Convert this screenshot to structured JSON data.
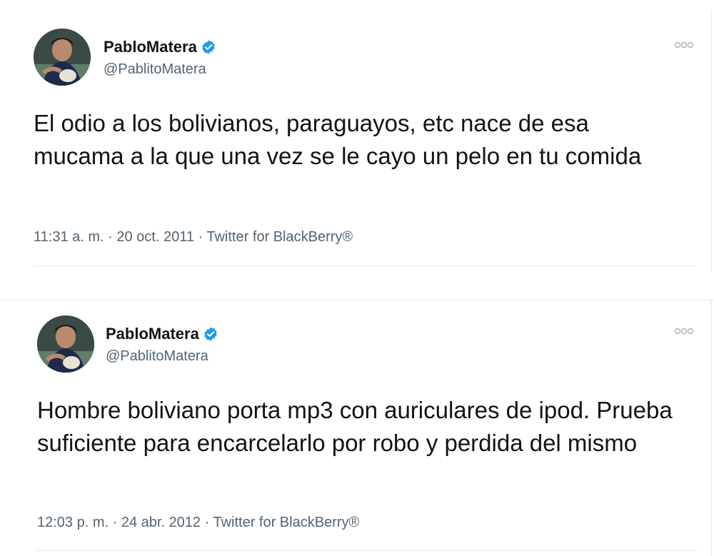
{
  "tweets": [
    {
      "display_name": "PabloMatera",
      "handle": "@PablitoMatera",
      "text": "El odio a los bolivianos, paraguayos, etc nace de esa mucama a la que una vez se le cayo un pelo en tu comida",
      "meta": "11:31 a. m. · 20 oct. 2011 · Twitter for BlackBerry®",
      "avatar_icon": "profile-photo",
      "verified_icon": "verified-badge-icon",
      "more_icon": "more-options-icon"
    },
    {
      "display_name": "PabloMatera",
      "handle": "@PablitoMatera",
      "text": "Hombre boliviano porta mp3 con auriculares de ipod. Prueba suficiente para encarcelarlo por robo y perdida del mismo",
      "meta": "12:03 p. m. · 24 abr. 2012 · Twitter for BlackBerry®",
      "avatar_icon": "profile-photo",
      "verified_icon": "verified-badge-icon",
      "more_icon": "more-options-icon"
    }
  ],
  "colors": {
    "verified_blue": "#1d9bf0",
    "text_primary": "#0f1419",
    "text_secondary": "#536471",
    "divider": "#e1e8ed"
  }
}
